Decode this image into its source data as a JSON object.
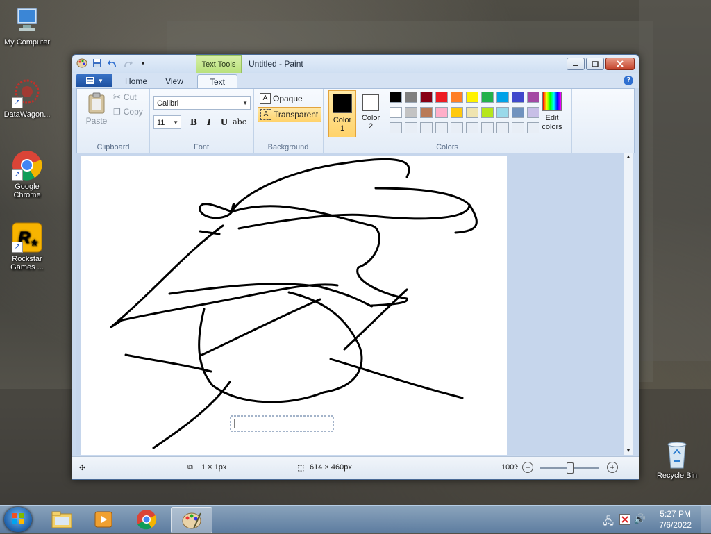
{
  "desktop": {
    "icons": [
      {
        "label": "My Computer"
      },
      {
        "label": "DataWagon..."
      },
      {
        "label": "Google Chrome"
      },
      {
        "label": "Rockstar Games ..."
      },
      {
        "label": "Recycle Bin"
      }
    ]
  },
  "window": {
    "context_tab_header": "Text Tools",
    "title": "Untitled - Paint",
    "tabs": [
      "Home",
      "View",
      "Text"
    ],
    "active_tab": "Text",
    "help": "?"
  },
  "ribbon": {
    "clipboard": {
      "paste": "Paste",
      "cut": "Cut",
      "copy": "Copy",
      "label": "Clipboard"
    },
    "font": {
      "family": "Calibri",
      "size": "11",
      "bold": "B",
      "italic": "I",
      "underline": "U",
      "strike": "abc",
      "label": "Font"
    },
    "background": {
      "opaque": "Opaque",
      "transparent": "Transparent",
      "selected": "Transparent",
      "label": "Background"
    },
    "colors": {
      "color1_label": "Color 1",
      "color1_line1": "Color",
      "color1_line2": "1",
      "color2_line1": "Color",
      "color2_line2": "2",
      "color1": "#000000",
      "color2": "#ffffff",
      "palette_row1": [
        "#000000",
        "#7f7f7f",
        "#880015",
        "#ed1c24",
        "#ff7f27",
        "#fff200",
        "#22b14c",
        "#00a2e8",
        "#3f48cc",
        "#a349a4"
      ],
      "palette_row2": [
        "#ffffff",
        "#c3c3c3",
        "#b97a57",
        "#ffaec9",
        "#ffc90e",
        "#efe4b0",
        "#b5e61d",
        "#99d9ea",
        "#7092be",
        "#c8bfe7"
      ],
      "edit_line1": "Edit",
      "edit_line2": "colors",
      "label": "Colors"
    }
  },
  "status": {
    "cursor_pos": "1 × 1px",
    "canvas_size": "614 × 460px",
    "zoom": "100%"
  },
  "taskbar": {
    "time": "5:27 PM",
    "date": "7/6/2022"
  }
}
